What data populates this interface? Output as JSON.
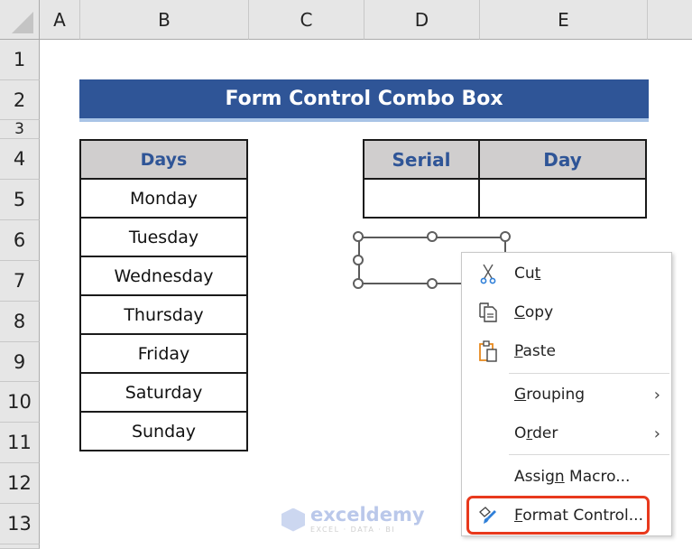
{
  "spreadsheet": {
    "columns": [
      "A",
      "B",
      "C",
      "D",
      "E"
    ],
    "rows": [
      "1",
      "2",
      "3",
      "4",
      "5",
      "6",
      "7",
      "8",
      "9",
      "10",
      "11",
      "12",
      "13"
    ]
  },
  "title": "Form Control Combo Box",
  "days_table": {
    "header": "Days",
    "values": [
      "Monday",
      "Tuesday",
      "Wednesday",
      "Thursday",
      "Friday",
      "Saturday",
      "Sunday"
    ]
  },
  "lookup_table": {
    "headers": [
      "Serial",
      "Day"
    ],
    "values": [
      "",
      ""
    ]
  },
  "context_menu": {
    "items": [
      {
        "label": "Cut",
        "underline_index": 2,
        "icon": "scissors-icon"
      },
      {
        "label": "Copy",
        "underline_index": 0,
        "icon": "copy-icon"
      },
      {
        "label": "Paste",
        "underline_index": 0,
        "icon": "paste-icon"
      },
      {
        "label": "Grouping",
        "underline_index": 0,
        "submenu": true
      },
      {
        "label": "Order",
        "underline_index": 1,
        "submenu": true
      },
      {
        "label": "Assign Macro...",
        "underline_index": 5
      },
      {
        "label": "Format Control...",
        "underline_index": 0,
        "icon": "format-control-icon",
        "highlighted": true
      }
    ]
  },
  "watermark": {
    "name": "exceldemy",
    "tagline": "EXCEL · DATA · BI"
  },
  "colors": {
    "title_bg": "#2f5597",
    "header_bg": "#d0cece",
    "header_text": "#2f5597",
    "highlight_border": "#e8391d"
  }
}
